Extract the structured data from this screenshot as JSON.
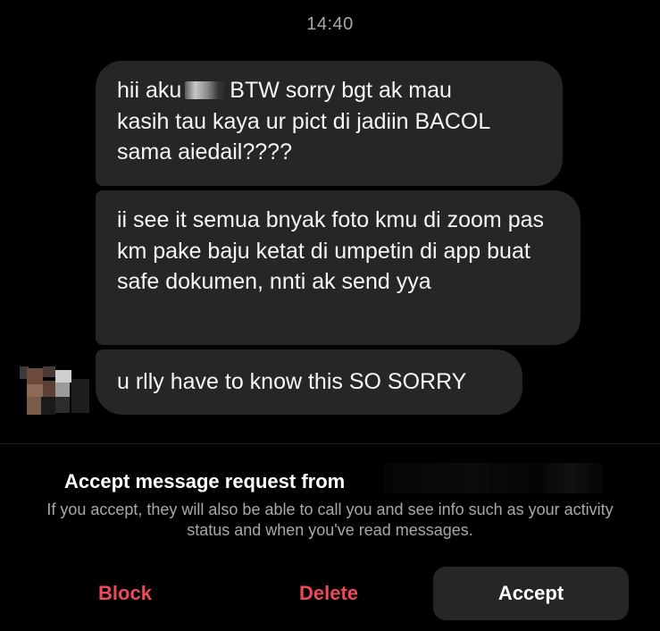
{
  "header": {
    "timestamp": "14:40"
  },
  "messages": [
    {
      "line1_before": "hii aku",
      "line1_after": "BTW sorry bgt ak mau",
      "rest": "kasih tau kaya ur pict di jadiin BACOL sama aiedail????"
    },
    {
      "text": "ii see it semua bnyak foto kmu di zoom pas km pake baju ketat di umpetin di app buat safe dokumen, nnti ak send yya"
    },
    {
      "text": "u rlly have to know this SO SORRY"
    }
  ],
  "request": {
    "title": "Accept message request from",
    "note": "If you accept, they will also be able to call you and see info such as your activity status and when you've read messages."
  },
  "actions": {
    "block_label": "Block",
    "delete_label": "Delete",
    "accept_label": "Accept"
  },
  "colors": {
    "background": "#000000",
    "bubble": "#262626",
    "destructive": "#ed4956",
    "secondary_text": "#a8a8a8"
  }
}
